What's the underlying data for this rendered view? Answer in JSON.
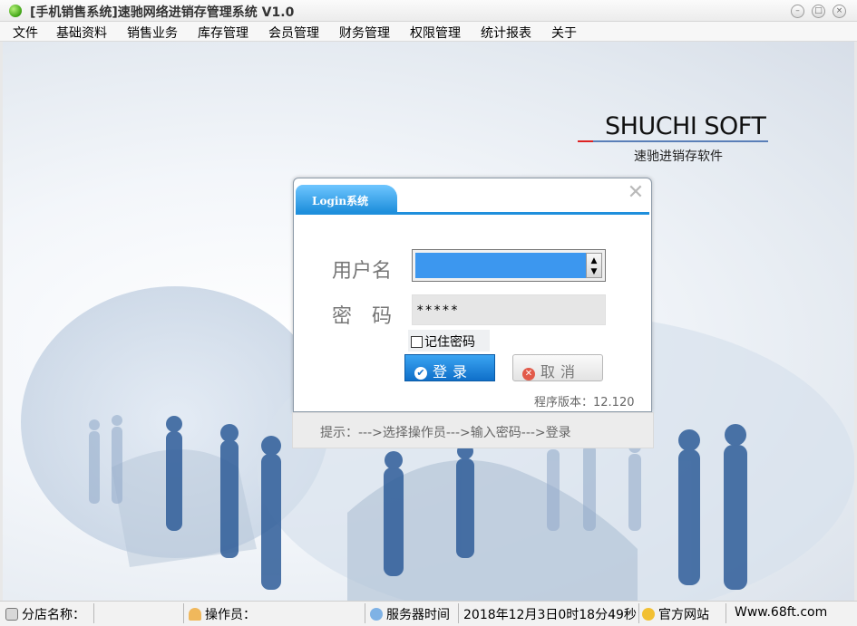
{
  "window": {
    "title": "[手机销售系统]速驰网络进销存管理系统 V1.0"
  },
  "menu": [
    "文件",
    "基础资料",
    "销售业务",
    "库存管理",
    "会员管理",
    "财务管理",
    "权限管理",
    "统计报表",
    "关于"
  ],
  "brand": {
    "name": "SHUCHI SOFT",
    "subtitle": "速驰进销存软件"
  },
  "login": {
    "tab_title": "Login系统",
    "username_label": "用户名",
    "username_value": "",
    "password_label": "密　码",
    "password_value": "*****",
    "remember_label": "记住密码",
    "remember_checked": false,
    "login_button": "登录",
    "cancel_button": "取消",
    "version_text": "程序版本：12.120",
    "hint_text": "提示：--->选择操作员--->输入密码--->登录"
  },
  "status": {
    "branch_label": "分店名称：",
    "operator_label": "操作员：",
    "server_time_label": "服务器时间",
    "server_time_value": "2018年12月3日0时18分49秒",
    "website_label": "官方网站",
    "website_value": "Www.68ft.com"
  },
  "colors": {
    "accent": "#1f8fdc",
    "selection": "#3c97ef",
    "login_button": "#0f6fc9"
  }
}
